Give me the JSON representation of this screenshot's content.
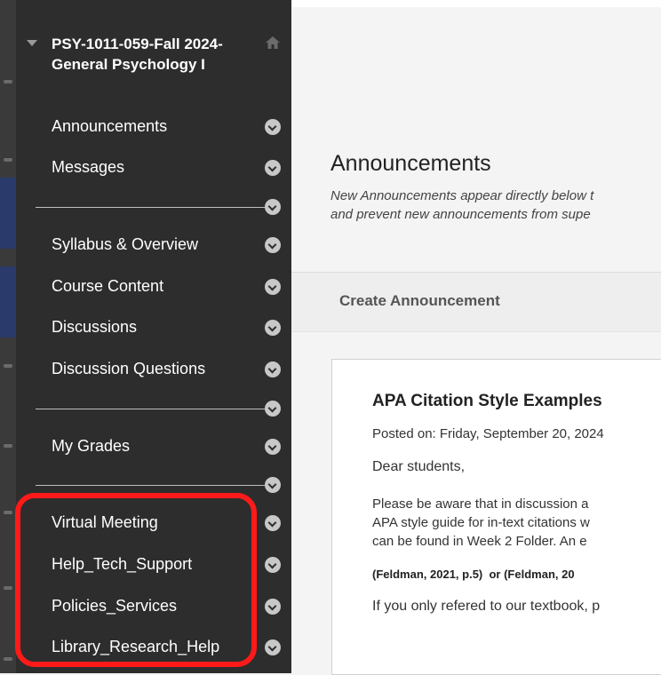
{
  "sidebar": {
    "course_title": "PSY-1011-059-Fall 2024-\nGeneral Psychology I",
    "items": [
      {
        "label": "Announcements"
      },
      {
        "label": "Messages"
      },
      {
        "label": "Syllabus & Overview"
      },
      {
        "label": "Course Content"
      },
      {
        "label": "Discussions"
      },
      {
        "label": "Discussion Questions"
      },
      {
        "label": "My Grades"
      },
      {
        "label": "Virtual Meeting"
      },
      {
        "label": "Help_Tech_Support"
      },
      {
        "label": "Policies_Services"
      },
      {
        "label": "Library_Research_Help"
      }
    ],
    "icons": {
      "collapse": "triangle-down-icon",
      "home": "home-icon",
      "item_menu": "chevron-down-circle-icon"
    },
    "highlight_color": "#ff1a1a"
  },
  "main": {
    "page_title": "Announcements",
    "page_description": "New Announcements appear directly below t\nand prevent new announcements from supe",
    "create_label": "Create Announcement",
    "announcement": {
      "title": "APA Citation Style Examples",
      "posted": "Posted on: Friday, September 20, 2024",
      "greeting": "Dear students,",
      "body": "Please be aware that in discussion a\nAPA style guide for in-text citations w\ncan be found in Week 2 Folder. An e",
      "citation": "(Feldman, 2021, p.5)  or (Feldman, 20",
      "last_line": "If you only refered to our textbook, p"
    }
  }
}
